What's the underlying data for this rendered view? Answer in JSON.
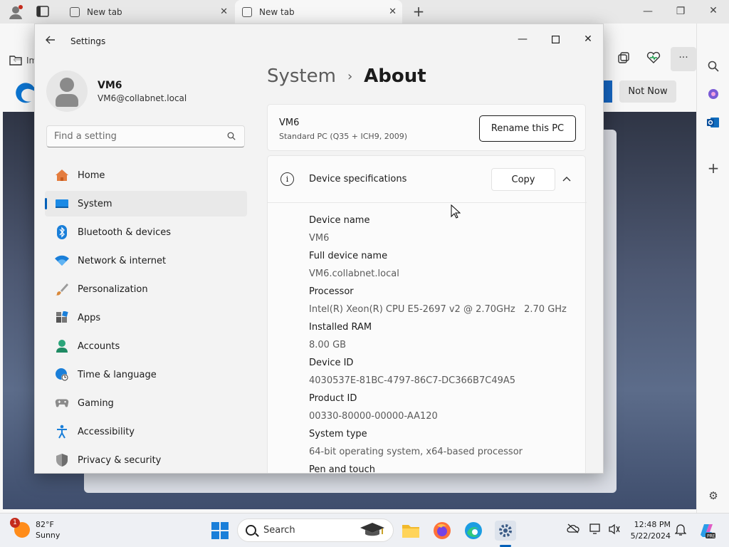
{
  "browser": {
    "tabs": [
      {
        "label": "New tab"
      },
      {
        "label": "New tab"
      }
    ],
    "new_tab": "+",
    "not_now_label": "Not Now",
    "partial_label": "Im"
  },
  "settings": {
    "window_title": "Settings",
    "profile": {
      "name": "VM6",
      "email": "VM6@collabnet.local"
    },
    "search_placeholder": "Find a setting",
    "nav": [
      {
        "label": "Home",
        "icon": "home-icon"
      },
      {
        "label": "System",
        "icon": "system-icon",
        "active": true
      },
      {
        "label": "Bluetooth & devices",
        "icon": "bluetooth-icon"
      },
      {
        "label": "Network & internet",
        "icon": "wifi-icon"
      },
      {
        "label": "Personalization",
        "icon": "brush-icon"
      },
      {
        "label": "Apps",
        "icon": "apps-icon"
      },
      {
        "label": "Accounts",
        "icon": "person-icon"
      },
      {
        "label": "Time & language",
        "icon": "globe-clock-icon"
      },
      {
        "label": "Gaming",
        "icon": "gamepad-icon"
      },
      {
        "label": "Accessibility",
        "icon": "accessibility-icon"
      },
      {
        "label": "Privacy & security",
        "icon": "shield-icon"
      }
    ],
    "breadcrumb": {
      "parent": "System",
      "separator": "›",
      "current": "About"
    },
    "pc": {
      "name": "VM6",
      "model": "Standard PC (Q35 + ICH9, 2009)",
      "rename_label": "Rename this PC"
    },
    "specs": {
      "title": "Device specifications",
      "copy_label": "Copy",
      "items": [
        {
          "label": "Device name",
          "value": "VM6"
        },
        {
          "label": "Full device name",
          "value": "VM6.collabnet.local"
        },
        {
          "label": "Processor",
          "value": "Intel(R) Xeon(R) CPU E5-2697 v2 @ 2.70GHz   2.70 GHz"
        },
        {
          "label": "Installed RAM",
          "value": "8.00 GB"
        },
        {
          "label": "Device ID",
          "value": "4030537E-81BC-4797-86C7-DC366B7C49A5"
        },
        {
          "label": "Product ID",
          "value": "00330-80000-00000-AA120"
        },
        {
          "label": "System type",
          "value": "64-bit operating system, x64-based processor"
        },
        {
          "label": "Pen and touch",
          "value": ""
        }
      ]
    }
  },
  "taskbar": {
    "weather": {
      "temp": "82°F",
      "condition": "Sunny",
      "badge": "1"
    },
    "search_label": "Search",
    "time": "12:48 PM",
    "date": "5/22/2024"
  },
  "colors": {
    "accent": "#005fb8",
    "badge": "#c42b1c"
  }
}
